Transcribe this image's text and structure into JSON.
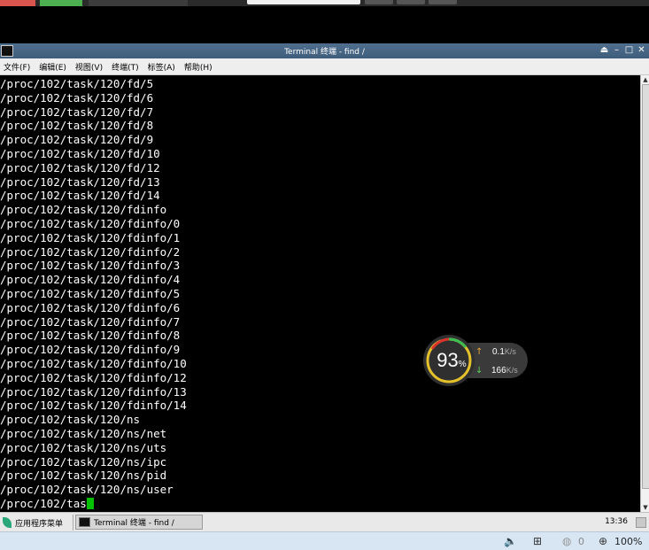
{
  "window": {
    "title": "Terminal 终端 - find /",
    "controls": [
      "⏏",
      "–",
      "□",
      "✕"
    ]
  },
  "menu": [
    "文件(F)",
    "编辑(E)",
    "视图(V)",
    "终端(T)",
    "标签(A)",
    "帮助(H)"
  ],
  "terminal": {
    "lines": [
      "/proc/102/task/120/fd/5",
      "/proc/102/task/120/fd/6",
      "/proc/102/task/120/fd/7",
      "/proc/102/task/120/fd/8",
      "/proc/102/task/120/fd/9",
      "/proc/102/task/120/fd/10",
      "/proc/102/task/120/fd/12",
      "/proc/102/task/120/fd/13",
      "/proc/102/task/120/fd/14",
      "/proc/102/task/120/fdinfo",
      "/proc/102/task/120/fdinfo/0",
      "/proc/102/task/120/fdinfo/1",
      "/proc/102/task/120/fdinfo/2",
      "/proc/102/task/120/fdinfo/3",
      "/proc/102/task/120/fdinfo/4",
      "/proc/102/task/120/fdinfo/5",
      "/proc/102/task/120/fdinfo/6",
      "/proc/102/task/120/fdinfo/7",
      "/proc/102/task/120/fdinfo/8",
      "/proc/102/task/120/fdinfo/9",
      "/proc/102/task/120/fdinfo/10",
      "/proc/102/task/120/fdinfo/12",
      "/proc/102/task/120/fdinfo/13",
      "/proc/102/task/120/fdinfo/14",
      "/proc/102/task/120/ns",
      "/proc/102/task/120/ns/net",
      "/proc/102/task/120/ns/uts",
      "/proc/102/task/120/ns/ipc",
      "/proc/102/task/120/ns/pid",
      "/proc/102/task/120/ns/user"
    ],
    "current_line": "/proc/102/tas",
    "cursor_color": "#00c000"
  },
  "net_widget": {
    "percent": "93",
    "percent_symbol": "%",
    "upload_value": "0.1",
    "upload_unit": "K/s",
    "download_value": "166",
    "download_unit": "K/s",
    "percent_fraction": 0.93
  },
  "taskbar": {
    "start_label": "应用程序菜单",
    "task_label": "Terminal 终端 - find /",
    "clock": "13:36"
  },
  "tray": {
    "zoom": "100%",
    "counter": "0"
  },
  "colors": {
    "titlebar": "#4a6886",
    "terminal_bg": "#000000",
    "terminal_fg": "#ffffff"
  }
}
